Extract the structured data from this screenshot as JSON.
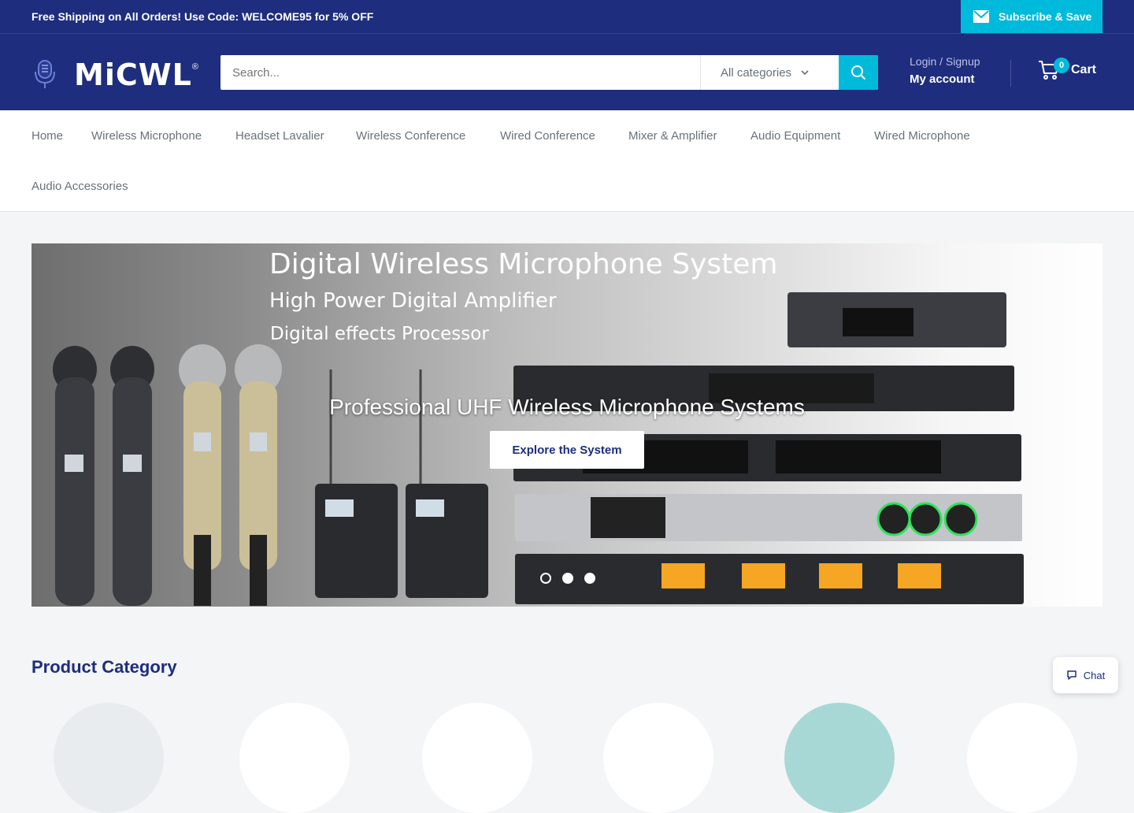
{
  "topbar": {
    "promo": "Free Shipping on All Orders! Use Code: WELCOME95 for 5% OFF",
    "subscribe_label": "Subscribe & Save"
  },
  "header": {
    "logo_text": "MiCWL",
    "search_placeholder": "Search...",
    "category_select": "All categories",
    "login_label": "Login / Signup",
    "account_label": "My account",
    "cart_count": "0",
    "cart_label": "Cart"
  },
  "nav": {
    "items": [
      "Home",
      "Wireless Microphone",
      "Headset Lavalier",
      "Wireless Conference",
      "Wired Conference",
      "Mixer & Amplifier",
      "Audio Equipment",
      "Wired Microphone",
      "Audio Accessories"
    ]
  },
  "hero": {
    "headline": "Digital Wireless Microphone System",
    "subline1": "High Power Digital Amplifier",
    "subline2": "Digital effects Processor",
    "overlay_title": "Professional UHF Wireless Microphone Systems",
    "cta_label": "Explore the System",
    "slides": 3,
    "active_slide": 2
  },
  "section": {
    "title": "Product Category"
  },
  "chat": {
    "label": "Chat"
  },
  "colors": {
    "brand": "#1e2d7d",
    "accent": "#00badb"
  }
}
